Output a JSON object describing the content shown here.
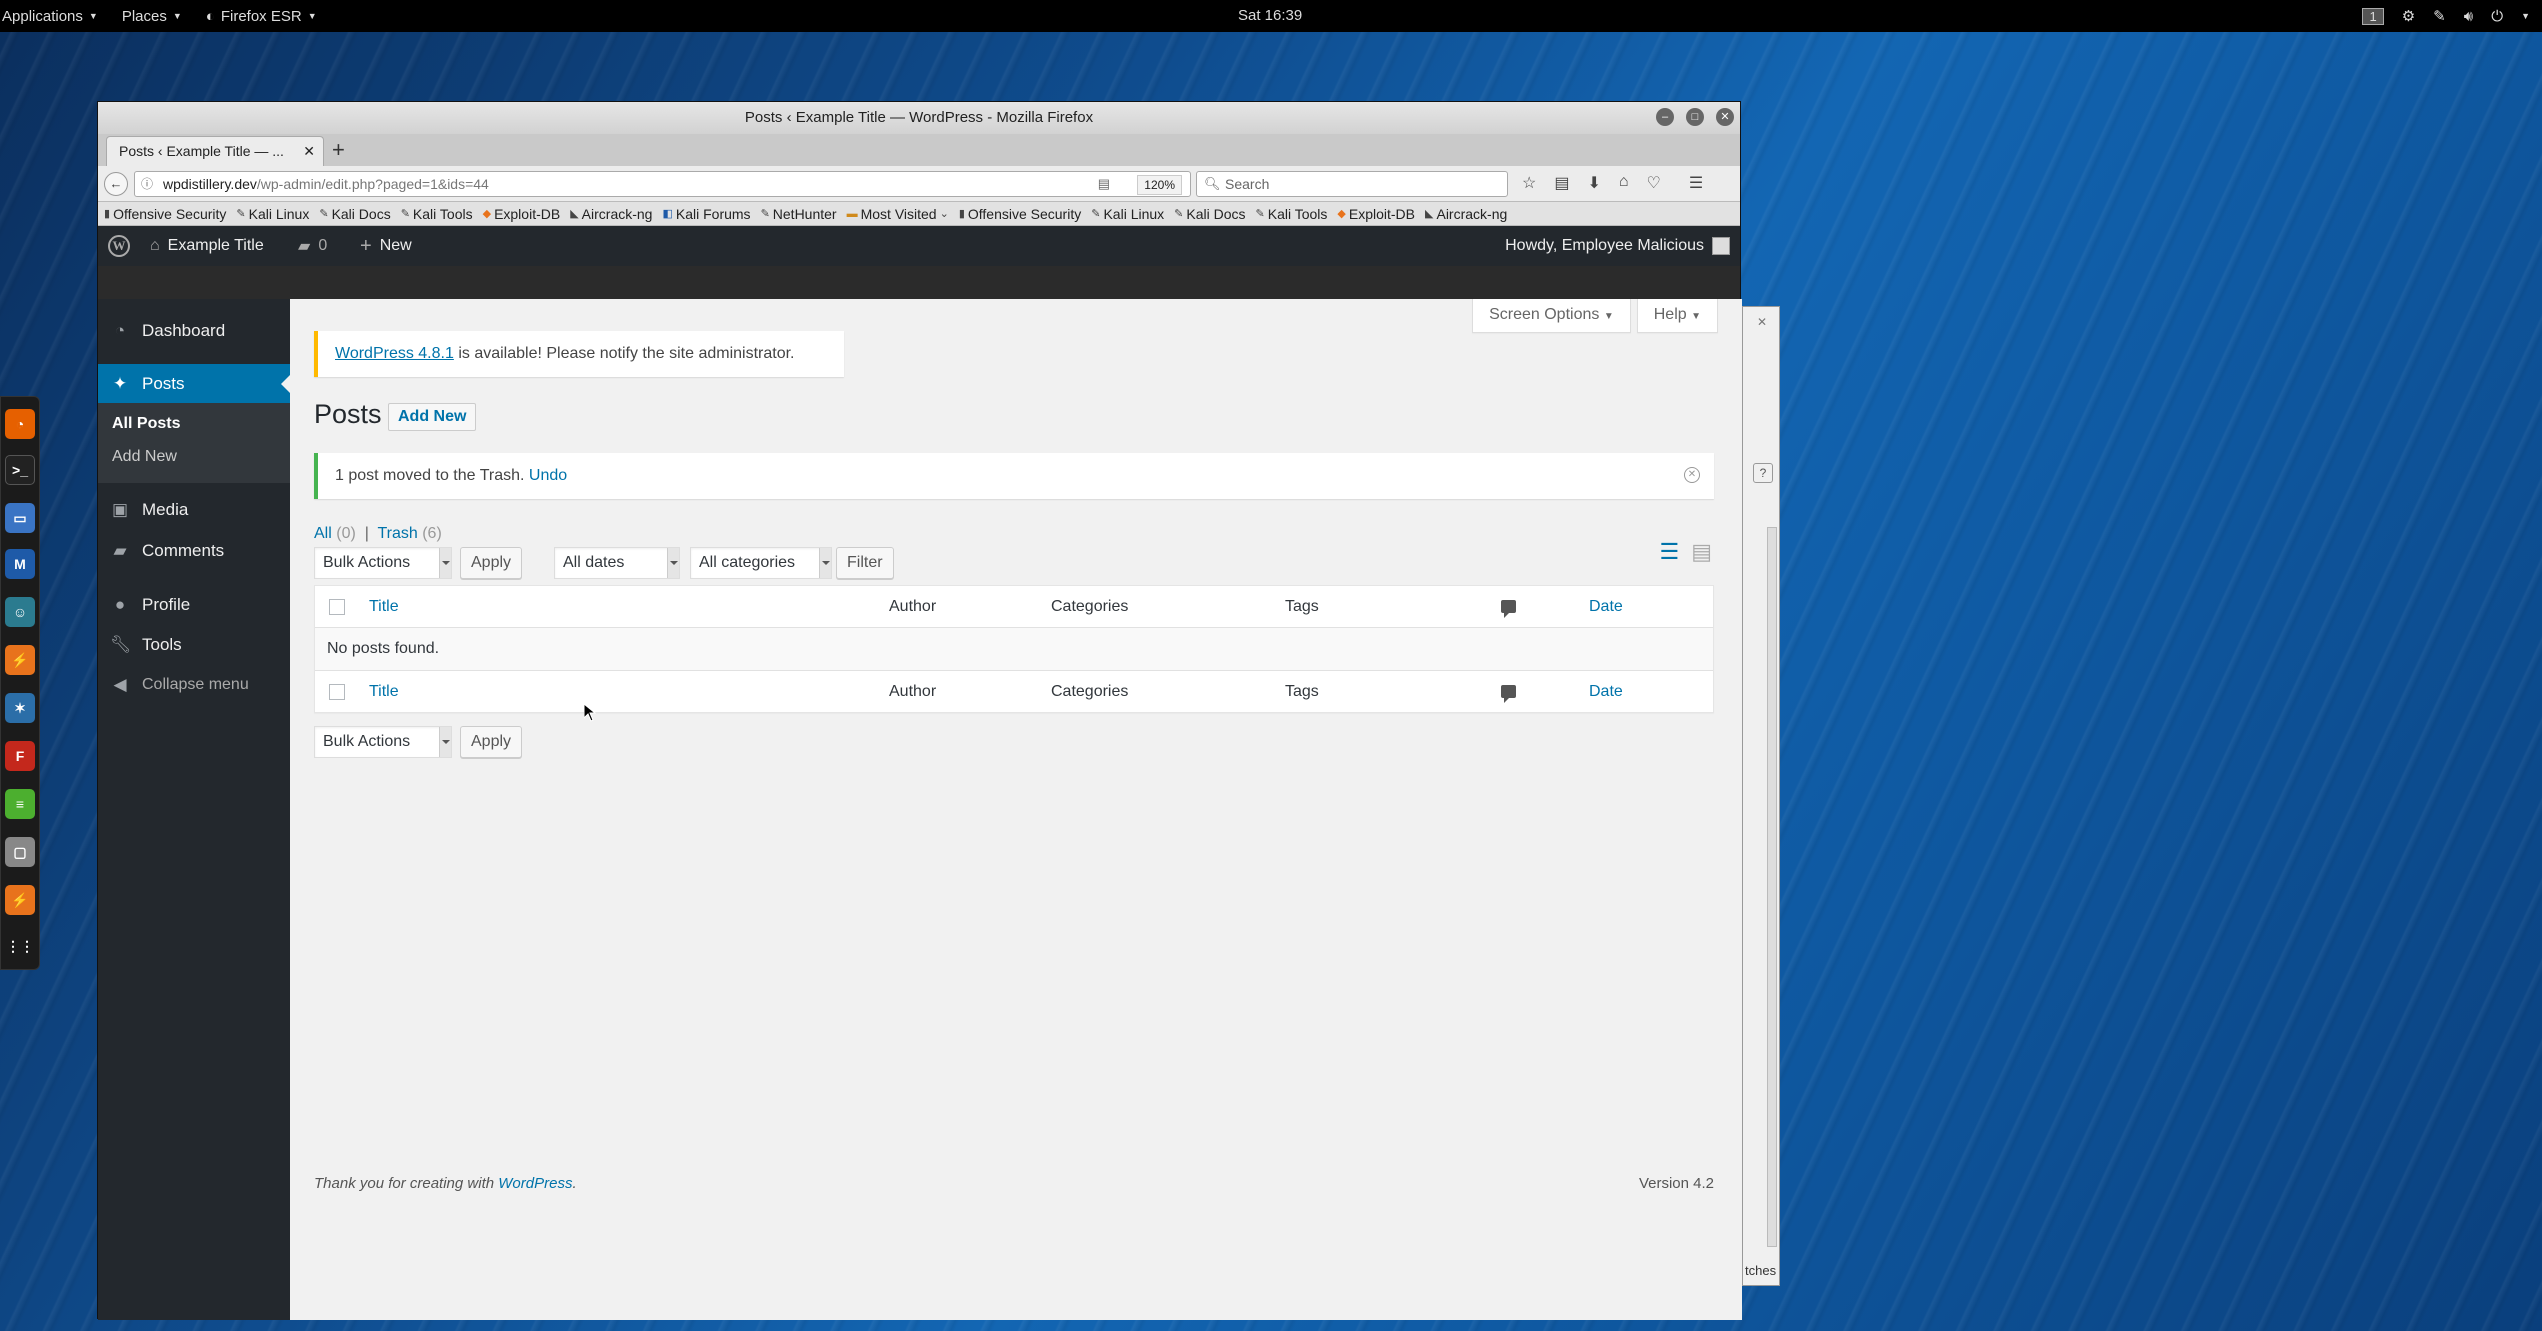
{
  "desktop": {
    "topbar": {
      "applications": "Applications",
      "places": "Places",
      "app_name": "Firefox ESR",
      "clock": "Sat 16:39",
      "workspace": "1"
    }
  },
  "window": {
    "title": "Posts ‹ Example Title — WordPress - Mozilla Firefox",
    "tab_label": "Posts ‹ Example Title — ...",
    "url_host": "wpdistillery.dev",
    "url_path": "/wp-admin/edit.php?paged=1&ids=44",
    "zoom": "120%",
    "search_placeholder": "Search",
    "bookmarks": [
      "Offensive Security",
      "Kali Linux",
      "Kali Docs",
      "Kali Tools",
      "Exploit-DB",
      "Aircrack-ng",
      "Kali Forums",
      "NetHunter",
      "Most Visited",
      "Offensive Security",
      "Kali Linux",
      "Kali Docs",
      "Kali Tools",
      "Exploit-DB",
      "Aircrack-ng"
    ]
  },
  "adminbar": {
    "site_name": "Example Title",
    "comments_count": "0",
    "new_label": "New",
    "howdy": "Howdy, Employee Malicious"
  },
  "sidebar": {
    "dashboard": "Dashboard",
    "posts": "Posts",
    "all_posts": "All Posts",
    "add_new": "Add New",
    "media": "Media",
    "comments": "Comments",
    "profile": "Profile",
    "tools": "Tools",
    "collapse": "Collapse menu"
  },
  "main": {
    "screen_options": "Screen Options",
    "help": "Help",
    "update_link": "WordPress 4.8.1",
    "update_text": " is available! Please notify the site administrator.",
    "page_title": "Posts",
    "add_new_button": "Add New",
    "trash_notice": "1 post moved to the Trash. ",
    "undo": "Undo",
    "filter_all": "All",
    "filter_all_count": "(0)",
    "filter_sep": "|",
    "filter_trash": "Trash",
    "filter_trash_count": "(6)",
    "bulk_actions": "Bulk Actions",
    "apply": "Apply",
    "all_dates": "All dates",
    "all_categories": "All categories",
    "filter_button": "Filter",
    "columns": {
      "title": "Title",
      "author": "Author",
      "categories": "Categories",
      "tags": "Tags",
      "date": "Date"
    },
    "no_posts": "No posts found.",
    "footer_text": "Thank you for creating with ",
    "footer_link": "WordPress",
    "footer_period": ".",
    "version": "Version 4.2"
  },
  "background_window": {
    "fragment": "tches"
  }
}
